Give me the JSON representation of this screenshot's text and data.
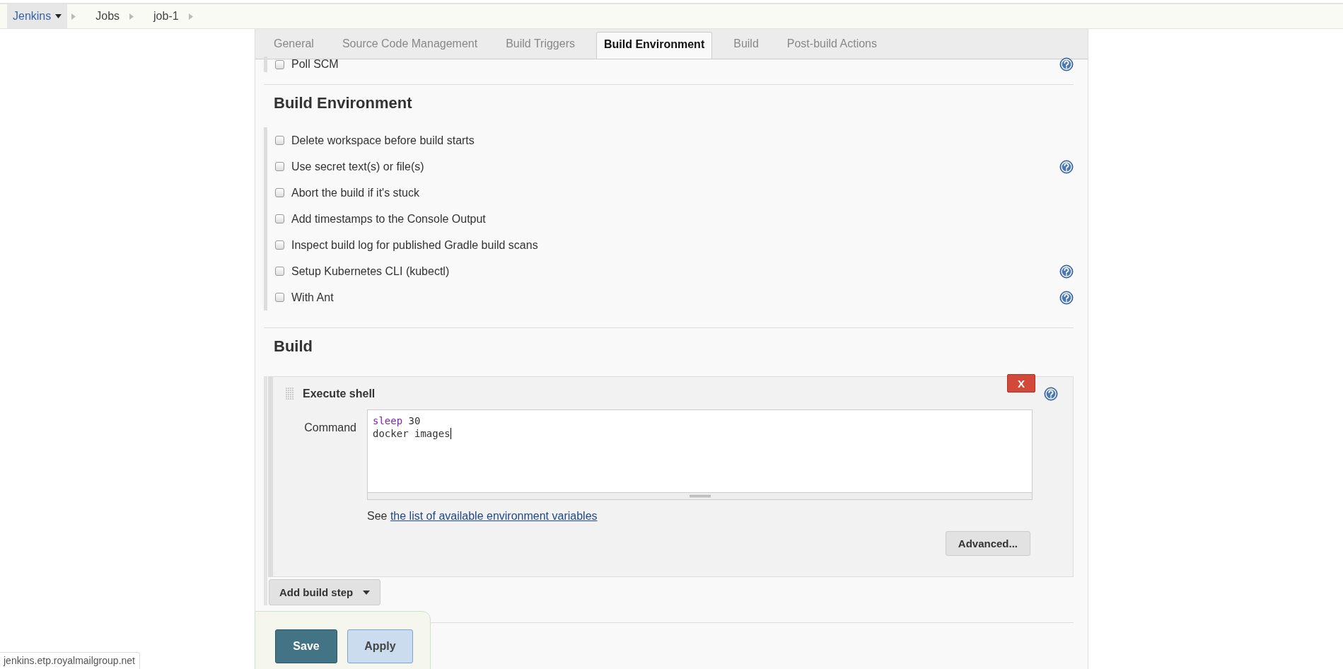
{
  "breadcrumbs": [
    {
      "label": "Jenkins",
      "menu": true
    },
    {
      "label": "Jobs",
      "menu": false
    },
    {
      "label": "job-1",
      "menu": false
    }
  ],
  "tabs": [
    {
      "label": "General",
      "selected": false
    },
    {
      "label": "Source Code Management",
      "selected": false
    },
    {
      "label": "Build Triggers",
      "selected": false
    },
    {
      "label": "Build Environment",
      "selected": true
    },
    {
      "label": "Build",
      "selected": false
    },
    {
      "label": "Post-build Actions",
      "selected": false
    }
  ],
  "build_triggers": {
    "options": [
      {
        "label": "Poll SCM",
        "checked": false,
        "help": true
      }
    ]
  },
  "build_environment": {
    "title": "Build Environment",
    "options": [
      {
        "label": "Delete workspace before build starts",
        "checked": false,
        "help": false
      },
      {
        "label": "Use secret text(s) or file(s)",
        "checked": false,
        "help": true
      },
      {
        "label": "Abort the build if it's stuck",
        "checked": false,
        "help": false
      },
      {
        "label": "Add timestamps to the Console Output",
        "checked": false,
        "help": false
      },
      {
        "label": "Inspect build log for published Gradle build scans",
        "checked": false,
        "help": false
      },
      {
        "label": "Setup Kubernetes CLI (kubectl)",
        "checked": false,
        "help": true
      },
      {
        "label": "With Ant",
        "checked": false,
        "help": true
      }
    ]
  },
  "build": {
    "title": "Build",
    "steps": [
      {
        "title": "Execute shell",
        "delete_label": "X",
        "help": true,
        "field_label": "Command",
        "command": [
          {
            "text": "sleep",
            "kind": "builtin"
          },
          {
            "text": " 30\ndocker images",
            "kind": "plain"
          }
        ],
        "hint_prefix": "See",
        "hint_link": "the list of available environment variables",
        "advanced_label": "Advanced..."
      }
    ],
    "add_label": "Add build step"
  },
  "save_bar": {
    "buttons": [
      {
        "label": "Save",
        "kind": "primary"
      },
      {
        "label": "Apply",
        "kind": "secondary"
      }
    ]
  },
  "status_url": "jenkins.etp.royalmailgroup.net"
}
